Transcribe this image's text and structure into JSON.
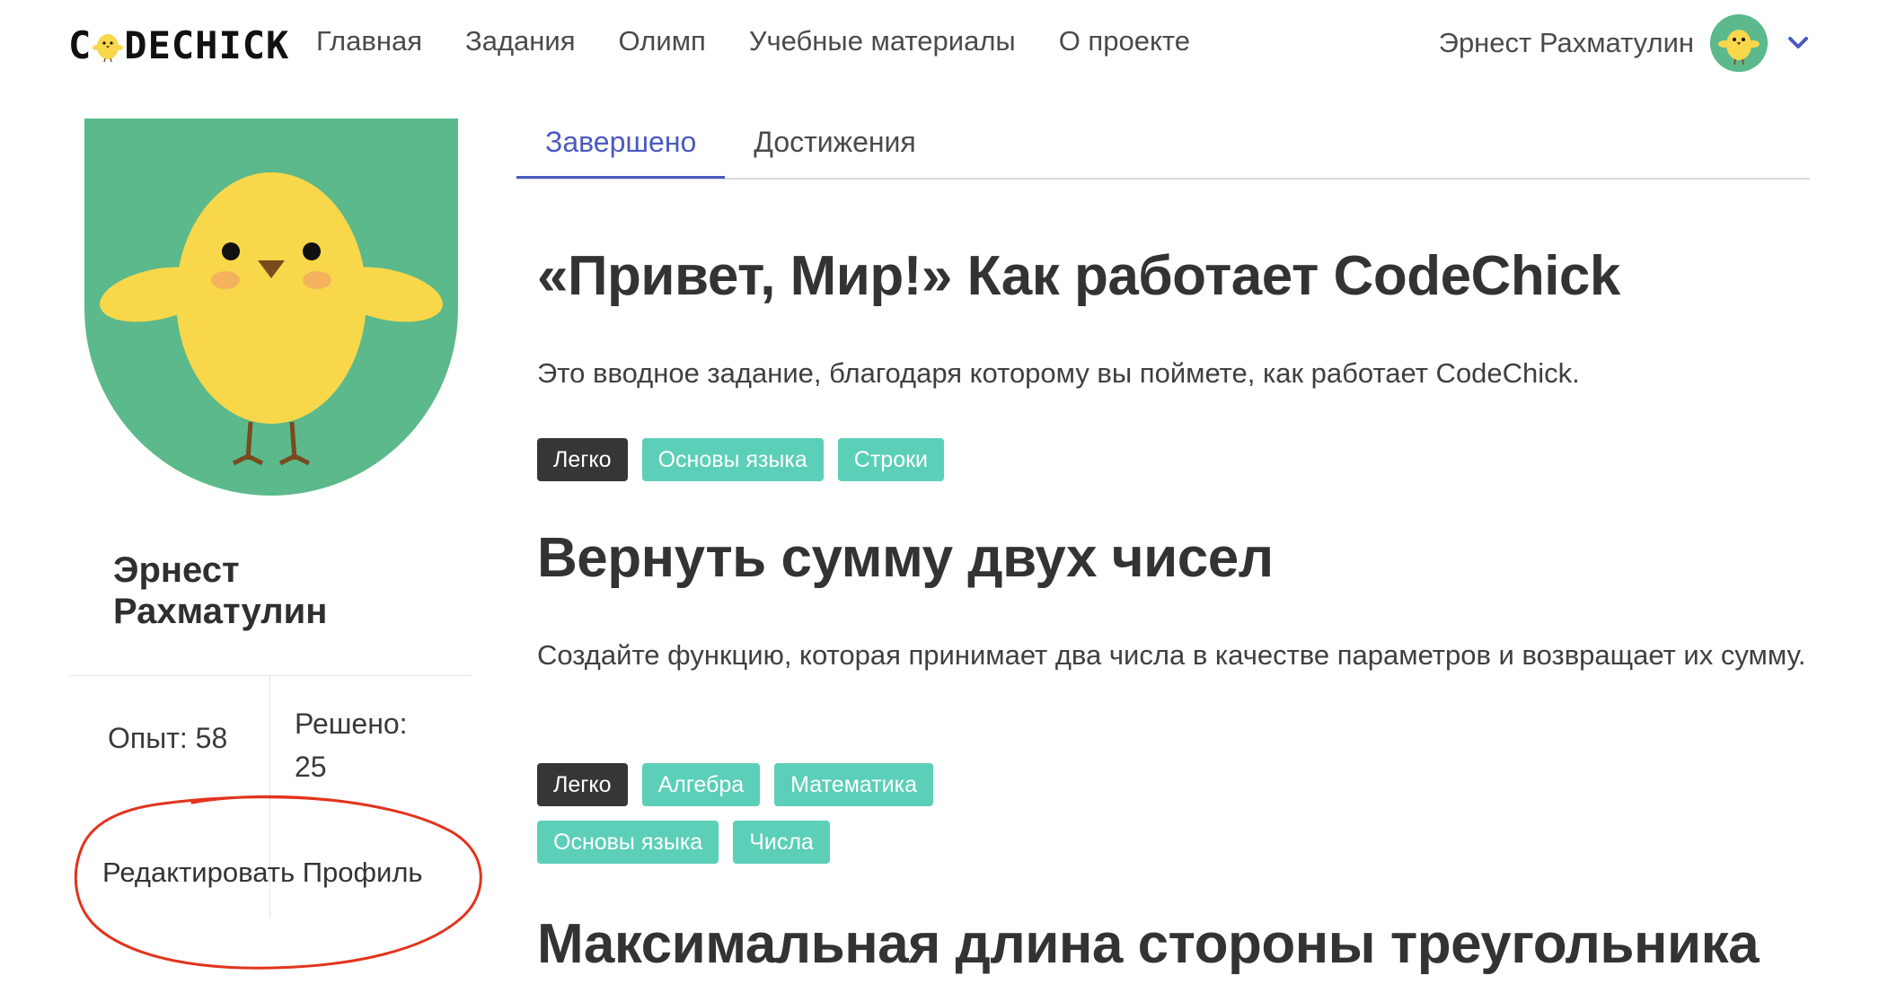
{
  "logo": {
    "text_before": "C",
    "text_after": "DECHICK"
  },
  "nav": {
    "items": [
      {
        "label": "Главная"
      },
      {
        "label": "Задания"
      },
      {
        "label": "Олимп"
      },
      {
        "label": "Учебные материалы"
      },
      {
        "label": "О проекте"
      }
    ]
  },
  "user_menu": {
    "name": "Эрнест Рахматулин",
    "dropdown_icon": "chevron-down-icon"
  },
  "profile": {
    "first_name": "Эрнест",
    "last_name": "Рахматулин",
    "experience": "Опыт: 58",
    "solved_label": "Решено:",
    "solved_value": "25",
    "edit_label": "Редактировать Профиль"
  },
  "tabs": [
    {
      "label": "Завершено",
      "active": true
    },
    {
      "label": "Достижения",
      "active": false
    }
  ],
  "tasks": [
    {
      "title": "«Привет, Мир!» Как работает CodeChick",
      "description": "Это вводное задание, благодаря которому вы поймете, как работает CodeChick.",
      "tags": [
        "Легко",
        "Основы языка",
        "Строки"
      ]
    },
    {
      "title": "Вернуть сумму двух чисел",
      "description": "Создайте функцию, которая принимает два числа в качестве параметров и возвращает их сумму.",
      "tags": [
        "Легко",
        "Алгебра",
        "Математика",
        "Основы языка",
        "Числа"
      ]
    },
    {
      "title": "Максимальная длина стороны треугольника"
    }
  ],
  "colors": {
    "accent": "#4b5ac0",
    "tag_teal": "#5ccfb8",
    "tag_dark": "#363636",
    "avatar_green": "#5bb98c",
    "chick_yellow": "#f9d74a",
    "annotation_red": "#e2341d"
  }
}
